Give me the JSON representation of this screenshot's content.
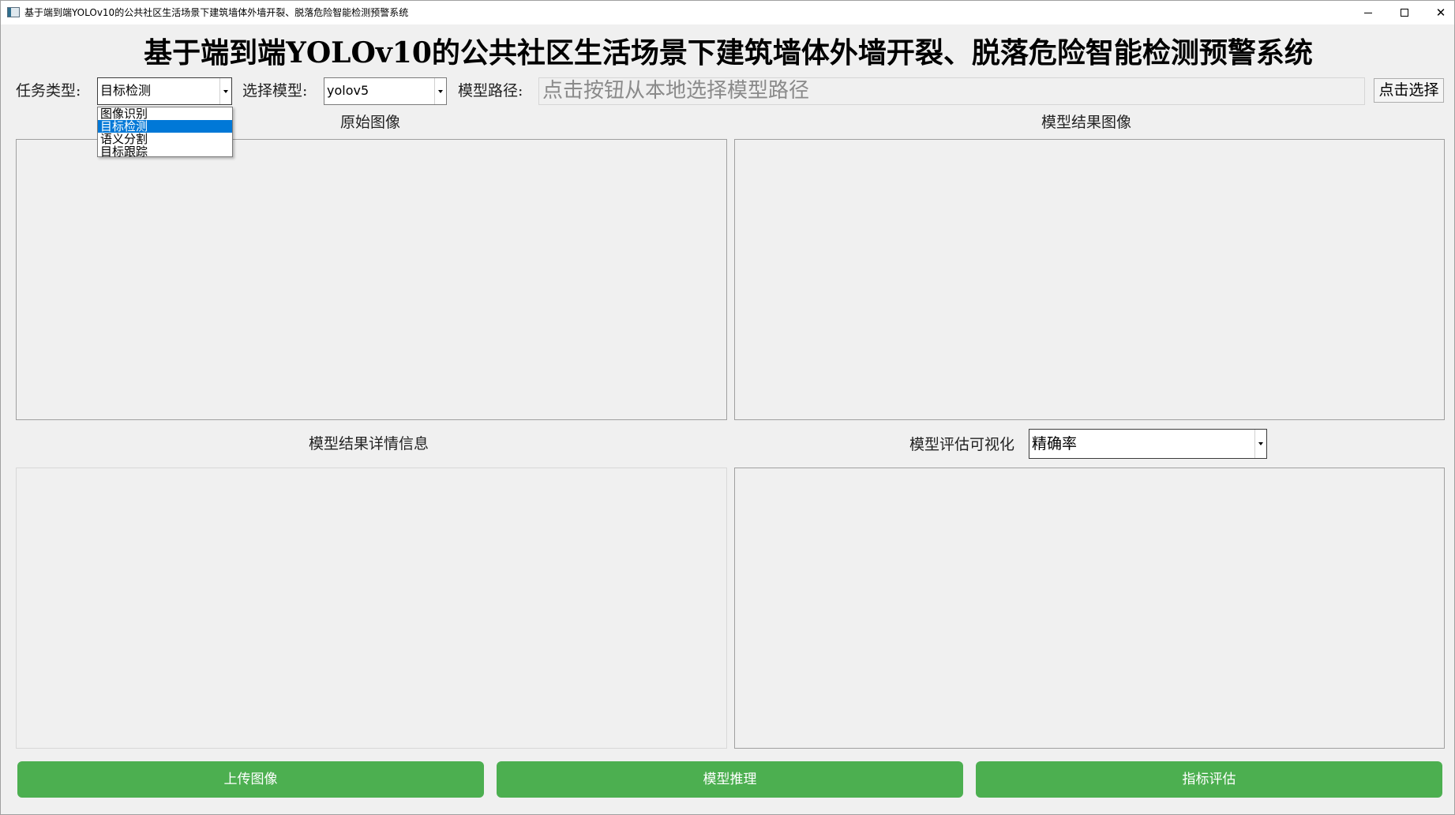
{
  "window": {
    "title": "基于端到端YOLOv10的公共社区生活场景下建筑墙体外墙开裂、脱落危险智能检测预警系统"
  },
  "header": {
    "title": "基于端到端YOLOv10的公共社区生活场景下建筑墙体外墙开裂、脱落危险智能检测预警系统"
  },
  "toolbar": {
    "task_type_label": "任务类型:",
    "task_type_value": "目标检测",
    "task_type_options": [
      "图像识别",
      "目标检测",
      "语义分割",
      "目标跟踪"
    ],
    "task_type_highlighted": "目标检测",
    "model_label": "选择模型:",
    "model_value": "yolov5",
    "model_path_label": "模型路径:",
    "model_path_placeholder": "点击按钮从本地选择模型路径",
    "browse_label": "点击选择"
  },
  "panels": {
    "original_image_label": "原始图像",
    "result_image_label": "模型结果图像",
    "result_detail_label": "模型结果详情信息",
    "eval_visual_label": "模型评估可视化",
    "eval_metric_value": "精确率"
  },
  "actions": {
    "upload_label": "上传图像",
    "infer_label": "模型推理",
    "evaluate_label": "指标评估"
  },
  "colors": {
    "action_button": "#4caf50",
    "selection": "#0078d7",
    "background": "#f0f0f0"
  }
}
